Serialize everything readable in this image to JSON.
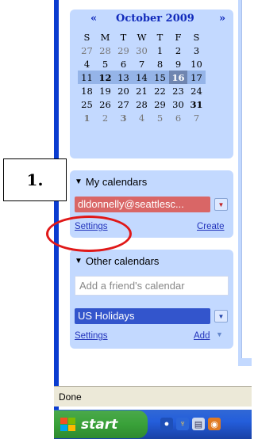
{
  "minical": {
    "prev": "«",
    "next": "»",
    "title": "October 2009",
    "weekdays": [
      "S",
      "M",
      "T",
      "W",
      "T",
      "F",
      "S"
    ],
    "weeks": [
      [
        "27",
        "28",
        "29",
        "30",
        "1",
        "2",
        "3"
      ],
      [
        "4",
        "5",
        "6",
        "7",
        "8",
        "9",
        "10"
      ],
      [
        "11",
        "12",
        "13",
        "14",
        "15",
        "16",
        "17"
      ],
      [
        "18",
        "19",
        "20",
        "21",
        "22",
        "23",
        "24"
      ],
      [
        "25",
        "26",
        "27",
        "28",
        "29",
        "30",
        "31"
      ],
      [
        "1",
        "2",
        "3",
        "4",
        "5",
        "6",
        "7"
      ]
    ]
  },
  "callout": {
    "label": "1."
  },
  "my_calendars": {
    "header": "My calendars",
    "calendar_name": "dldonnelly@seattlesc...",
    "settings_link": "Settings",
    "create_link": "Create"
  },
  "other_calendars": {
    "header": "Other calendars",
    "add_placeholder": "Add a friend's calendar",
    "calendar_name": "US Holidays",
    "settings_link": "Settings",
    "add_link": "Add"
  },
  "statusbar": {
    "text": "Done"
  },
  "taskbar": {
    "start_label": "start"
  },
  "colors": {
    "panel": "#c3d9ff",
    "my_calendar_chip": "#d96666",
    "other_calendar_chip": "#3355cc",
    "highlight_oval": "#e01818"
  }
}
